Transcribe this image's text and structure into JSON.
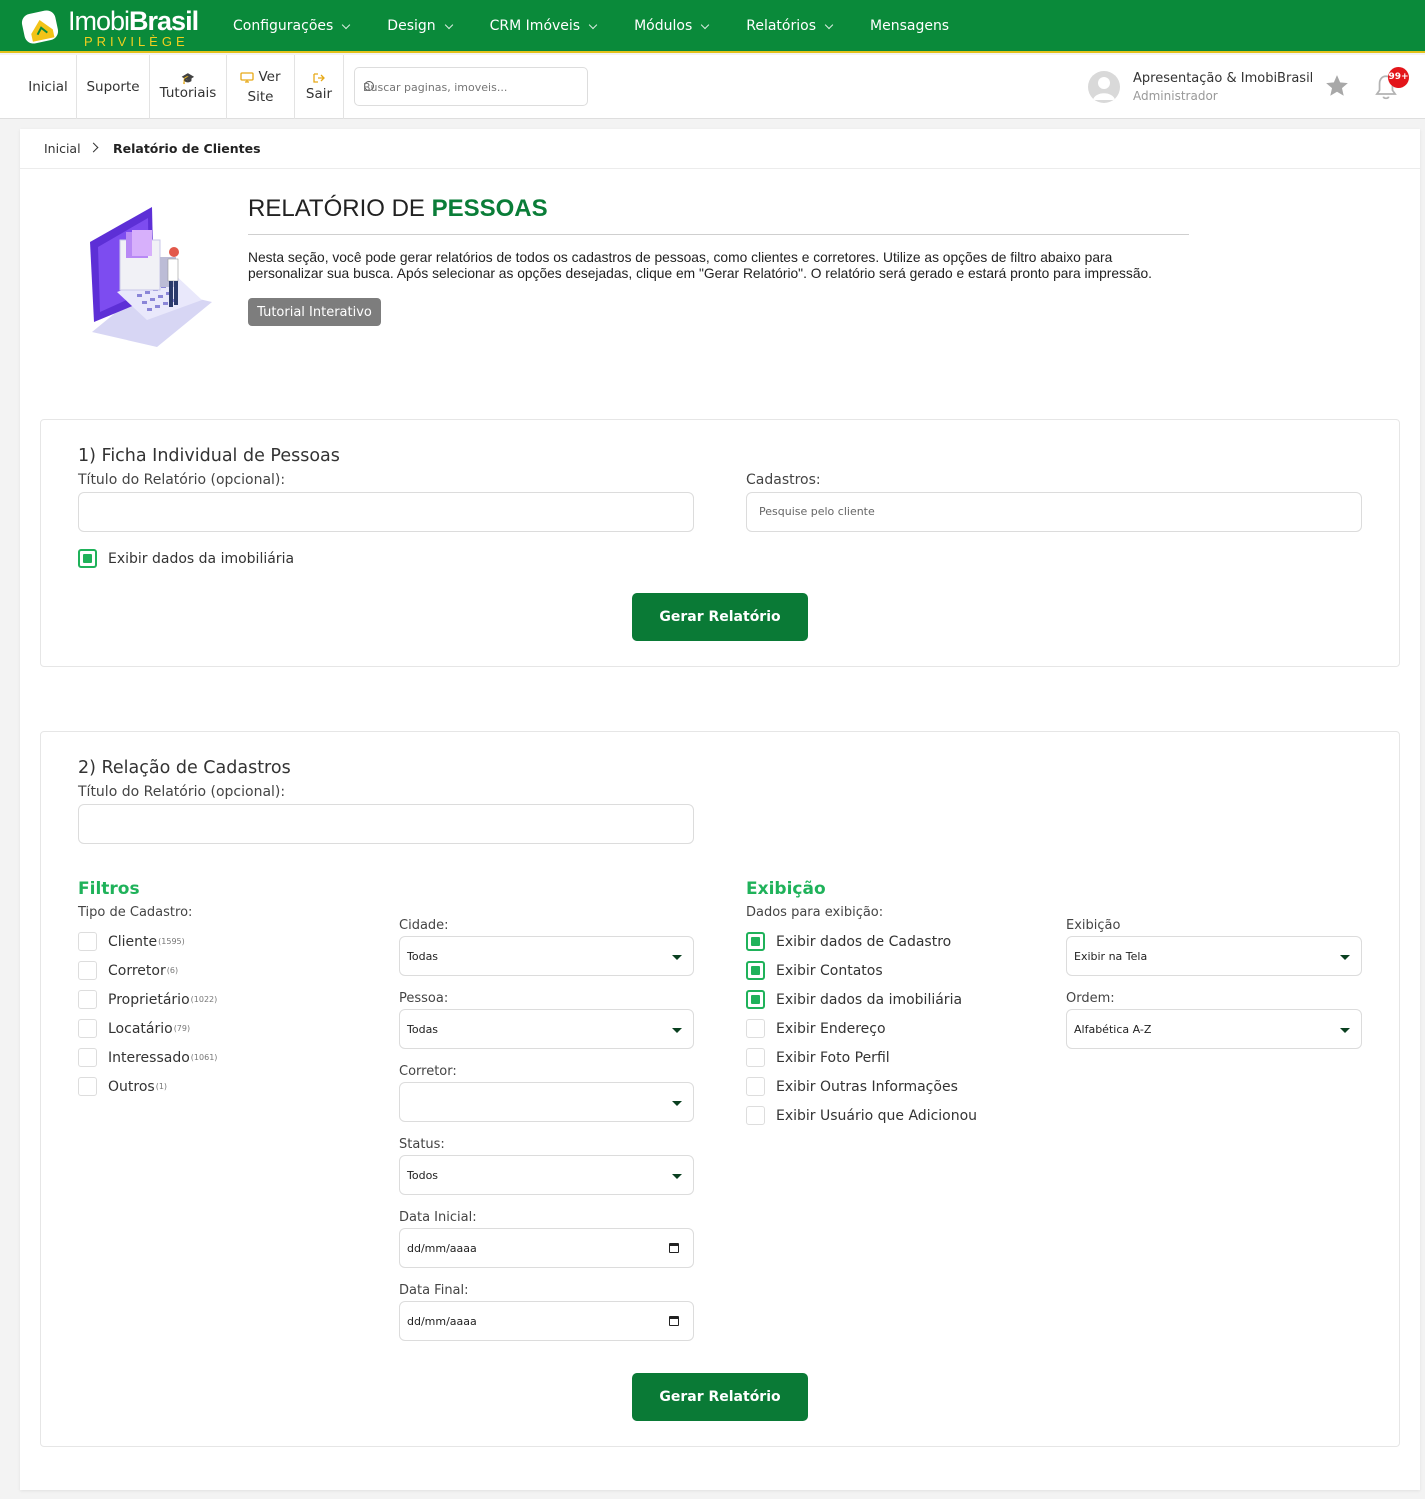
{
  "brand": {
    "name_light": "Imobi",
    "name_bold": "Brasil",
    "tagline": "PRIVILÈGE"
  },
  "mainnav": [
    {
      "label": "Configurações",
      "dropdown": true
    },
    {
      "label": "Design",
      "dropdown": true
    },
    {
      "label": "CRM Imóveis",
      "dropdown": true
    },
    {
      "label": "Módulos",
      "dropdown": true
    },
    {
      "label": "Relatórios",
      "dropdown": true
    },
    {
      "label": "Mensagens",
      "dropdown": false
    }
  ],
  "quicklinks": {
    "inicial": "Inicial",
    "suporte": "Suporte",
    "tutoriais": "Tutoriais",
    "ver": "Ver",
    "site": "Site",
    "sair": "Sair"
  },
  "search": {
    "placeholder": "Buscar paginas, imoveis..."
  },
  "user": {
    "name": "Apresentação & ImobiBrasil",
    "role": "Administrador"
  },
  "notifications": {
    "badge": "99+"
  },
  "breadcrumb": {
    "home": "Inicial",
    "current": "Relatório de Clientes"
  },
  "page": {
    "title_prefix": "RELATÓRIO DE ",
    "title_highlight": "PESSOAS",
    "description": "Nesta seção, você pode gerar relatórios de todos os cadastros de pessoas, como clientes e corretores. Utilize as opções de filtro abaixo para personalizar sua busca. Após selecionar as opções desejadas, clique em \"Gerar Relatório\". O relatório será gerado e estará pronto para impressão.",
    "tutorial_button": "Tutorial Interativo"
  },
  "section1": {
    "title": "1) Ficha Individual de Pessoas",
    "title_label": "Título do Relatório (opcional):",
    "title_value": "",
    "cadastros_label": "Cadastros:",
    "cadastros_placeholder": "Pesquise pelo cliente",
    "show_agency_label": "Exibir dados da imobiliária",
    "show_agency_checked": true,
    "button": "Gerar Relatório"
  },
  "section2": {
    "title": "2) Relação de Cadastros",
    "title_label": "Título do Relatório (opcional):",
    "title_value": "",
    "filters_heading": "Filtros",
    "tipo_label": "Tipo de Cadastro:",
    "tipos": [
      {
        "label": "Cliente",
        "count": "(1595)",
        "checked": false
      },
      {
        "label": "Corretor",
        "count": "(6)",
        "checked": false
      },
      {
        "label": "Proprietário",
        "count": "(1022)",
        "checked": false
      },
      {
        "label": "Locatário",
        "count": "(79)",
        "checked": false
      },
      {
        "label": "Interessado",
        "count": "(1061)",
        "checked": false
      },
      {
        "label": "Outros",
        "count": "(1)",
        "checked": false
      }
    ],
    "cidade": {
      "label": "Cidade:",
      "value": "Todas"
    },
    "pessoa": {
      "label": "Pessoa:",
      "value": "Todas"
    },
    "corretor": {
      "label": "Corretor:",
      "value": ""
    },
    "status": {
      "label": "Status:",
      "value": "Todos"
    },
    "data_inicial": {
      "label": "Data Inicial:",
      "value": "dd/mm/aaaa"
    },
    "data_final": {
      "label": "Data Final:",
      "value": "dd/mm/aaaa"
    },
    "display_heading": "Exibição",
    "dados_label": "Dados para exibição:",
    "dados": [
      {
        "label": "Exibir dados de Cadastro",
        "checked": true
      },
      {
        "label": "Exibir Contatos",
        "checked": true
      },
      {
        "label": "Exibir dados da imobiliária",
        "checked": true
      },
      {
        "label": "Exibir Endereço",
        "checked": false
      },
      {
        "label": "Exibir Foto Perfil",
        "checked": false
      },
      {
        "label": "Exibir Outras Informações",
        "checked": false
      },
      {
        "label": "Exibir Usuário que Adicionou",
        "checked": false
      }
    ],
    "exibicao": {
      "label": "Exibição",
      "value": "Exibir na Tela"
    },
    "ordem": {
      "label": "Ordem:",
      "value": "Alfabética A-Z"
    },
    "button": "Gerar Relatório"
  },
  "colors": {
    "primary": "#0a8a3a",
    "accent_yellow": "#e3c21a",
    "button_green": "#0a7a36",
    "check_green": "#1fb25a",
    "badge_red": "#e3151a"
  }
}
